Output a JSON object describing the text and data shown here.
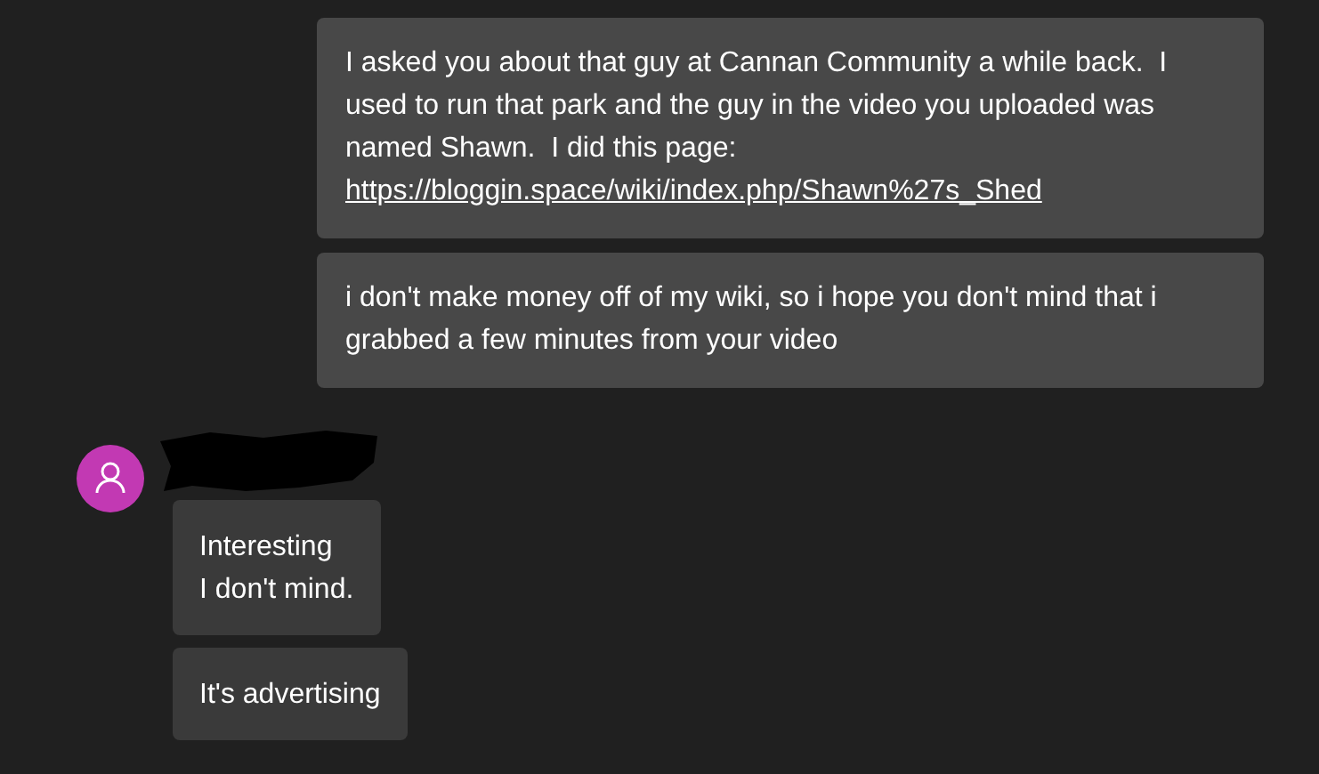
{
  "outgoing": [
    {
      "text": "I asked you about that guy at Cannan Community a while back.  I used to run that park and the guy in the video you uploaded was named Shawn.  I did this page:  ",
      "link": "https://bloggin.space/wiki/index.php/Shawn%27s_Shed"
    },
    {
      "text": "i don't make money off of my wiki, so i hope you don't mind that i grabbed a few minutes from your video"
    }
  ],
  "incoming": {
    "sender": {
      "name_redacted": true
    },
    "messages": [
      {
        "lines": [
          "Interesting",
          "I don't mind."
        ]
      },
      {
        "lines": [
          "It's advertising"
        ]
      }
    ]
  }
}
